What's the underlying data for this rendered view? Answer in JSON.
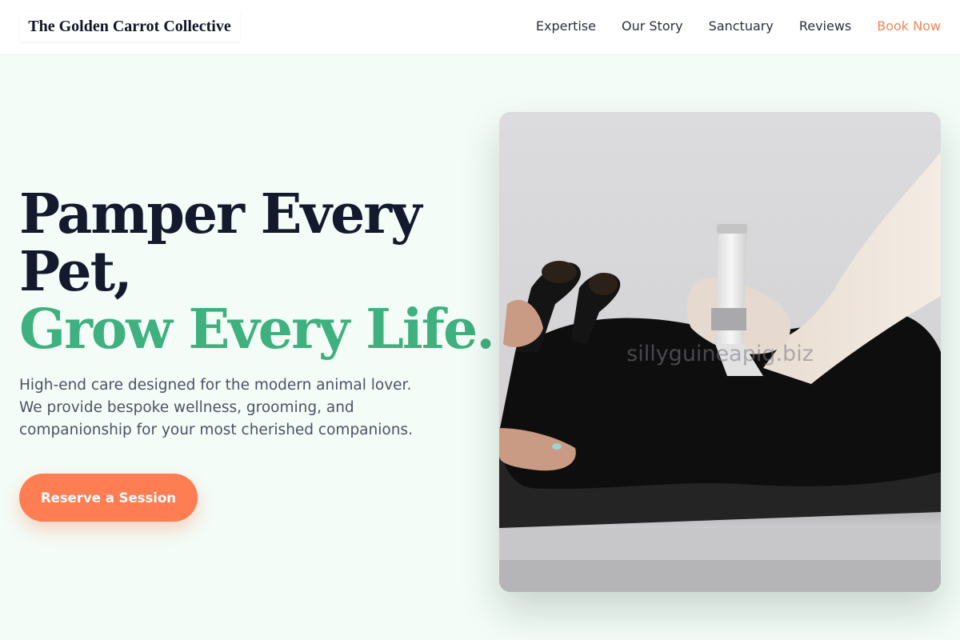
{
  "header": {
    "logo": "The Golden Carrot Collective",
    "nav": [
      {
        "label": "Expertise"
      },
      {
        "label": "Our Story"
      },
      {
        "label": "Sanctuary"
      },
      {
        "label": "Reviews"
      },
      {
        "label": "Book Now"
      }
    ]
  },
  "hero": {
    "title_line1": "Pamper Every",
    "title_line2": "Pet,",
    "title_line3": "Grow Every Life.",
    "description_lines": [
      "High-end care designed for the modern animal lover.",
      "We provide bespoke wellness, grooming, and",
      "companionship for your most cherished companions."
    ],
    "cta_label": "Reserve a Session",
    "image_watermark": "sillyguineapig.biz"
  },
  "colors": {
    "accent_green": "#3fb07f",
    "accent_orange": "#ff7d52",
    "background": "#f3fcf7"
  }
}
